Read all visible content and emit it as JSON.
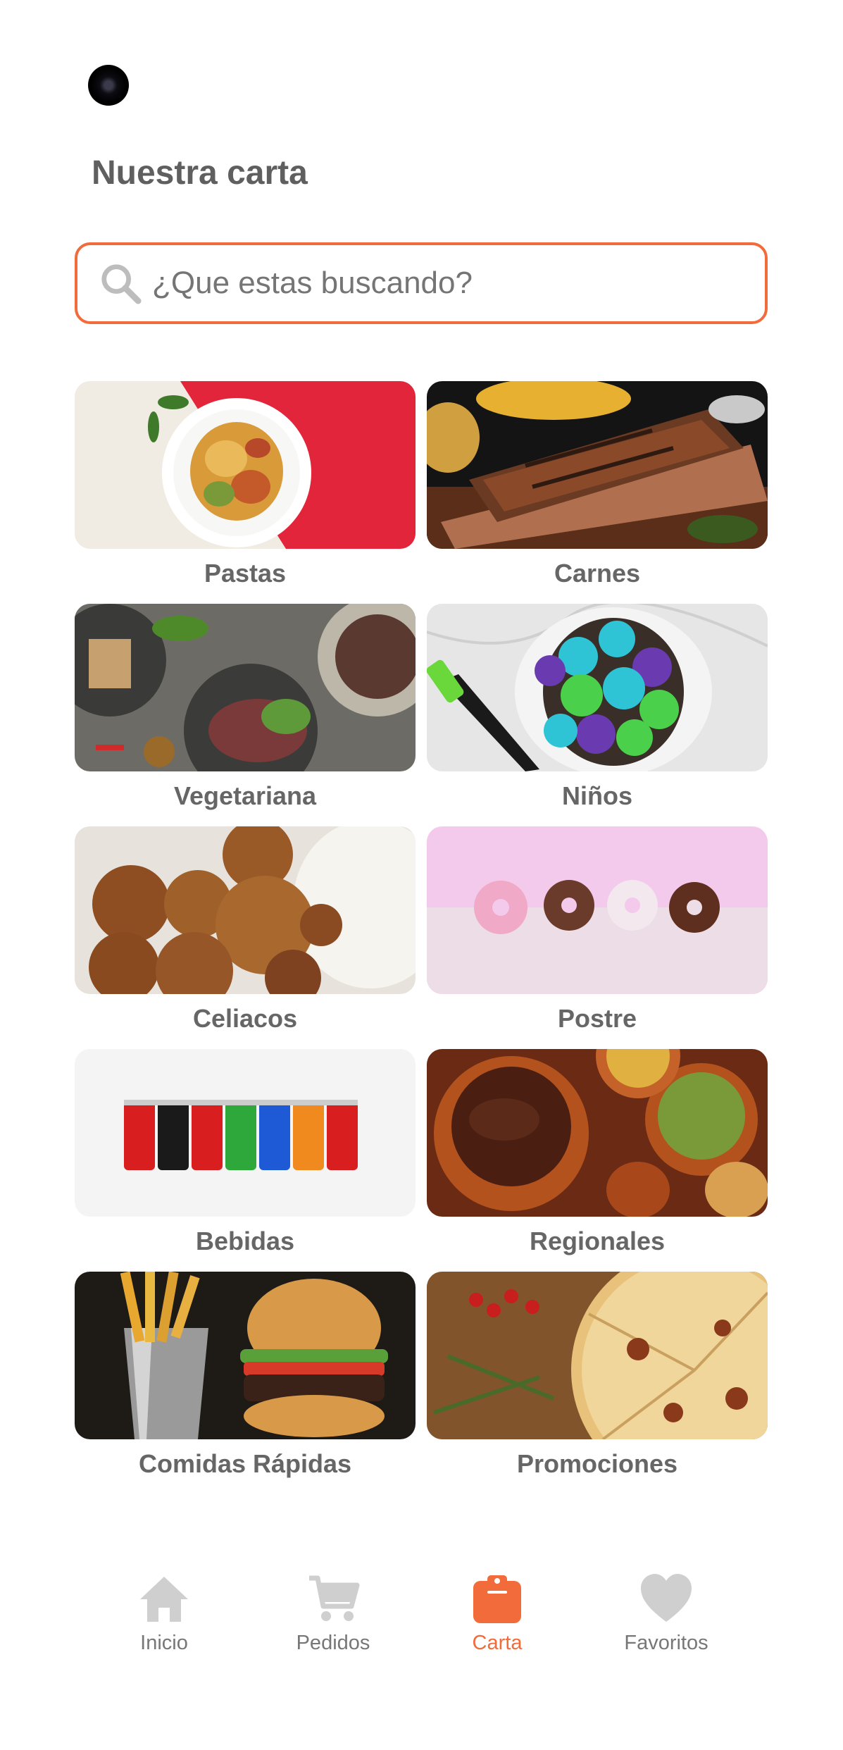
{
  "header": {
    "title": "Nuestra carta"
  },
  "search": {
    "placeholder": "¿Que estas buscando?"
  },
  "categories": [
    {
      "label": "Pastas"
    },
    {
      "label": "Carnes"
    },
    {
      "label": "Vegetariana"
    },
    {
      "label": "Niños"
    },
    {
      "label": "Celiacos"
    },
    {
      "label": "Postre"
    },
    {
      "label": "Bebidas"
    },
    {
      "label": "Regionales"
    },
    {
      "label": "Comidas Rápidas"
    },
    {
      "label": "Promociones"
    }
  ],
  "nav": {
    "items": [
      {
        "label": "Inicio",
        "icon": "home-icon"
      },
      {
        "label": "Pedidos",
        "icon": "cart-icon"
      },
      {
        "label": "Carta",
        "icon": "clipboard-icon",
        "active": true
      },
      {
        "label": "Favoritos",
        "icon": "heart-icon"
      }
    ],
    "active_color": "#f26b3a",
    "inactive_color": "#cfcfcf"
  },
  "colors": {
    "accent": "#f26b3a"
  }
}
